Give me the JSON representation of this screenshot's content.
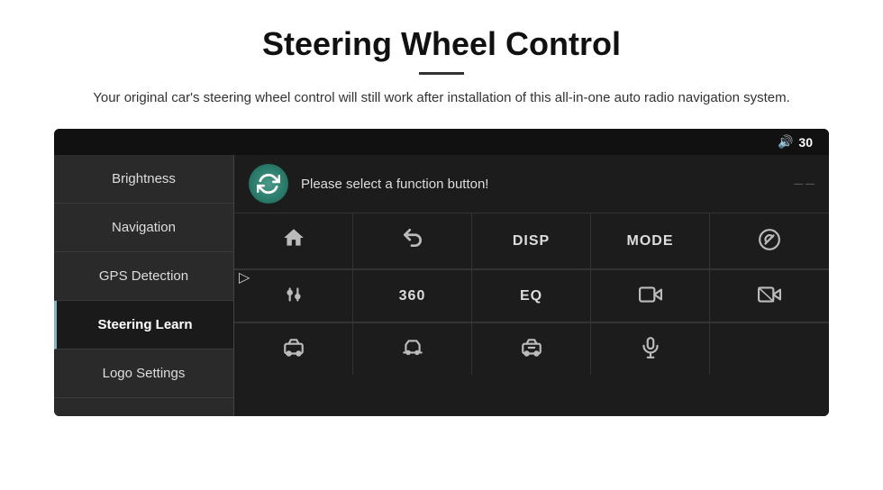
{
  "header": {
    "title": "Steering Wheel Control",
    "subtitle": "Your original car's steering wheel control will still work after installation of this all-in-one auto radio navigation system."
  },
  "screen": {
    "topbar": {
      "volume_label": "30"
    },
    "sidebar": {
      "items": [
        {
          "label": "Brightness",
          "active": false
        },
        {
          "label": "Navigation",
          "active": false
        },
        {
          "label": "GPS Detection",
          "active": false
        },
        {
          "label": "Steering Learn",
          "active": true
        },
        {
          "label": "Logo Settings",
          "active": false
        }
      ]
    },
    "prompt": "Please select a function button!",
    "grid": {
      "row1": [
        {
          "type": "icon",
          "symbol": "🏠",
          "label": "home"
        },
        {
          "type": "icon",
          "symbol": "↩",
          "label": "back"
        },
        {
          "type": "text",
          "symbol": "DISP",
          "label": "disp"
        },
        {
          "type": "text",
          "symbol": "MODE",
          "label": "mode"
        },
        {
          "type": "icon",
          "symbol": "🚫📞",
          "label": "no-call"
        }
      ],
      "row2": [
        {
          "type": "icon",
          "symbol": "⚙",
          "label": "settings"
        },
        {
          "type": "text",
          "symbol": "360",
          "label": "360"
        },
        {
          "type": "text",
          "symbol": "EQ",
          "label": "eq"
        },
        {
          "type": "icon",
          "symbol": "🍺",
          "label": "icon4"
        },
        {
          "type": "icon",
          "symbol": "🎭",
          "label": "icon5"
        }
      ],
      "row3": [
        {
          "type": "icon",
          "symbol": "🚗",
          "label": "car"
        },
        {
          "type": "icon",
          "symbol": "🚙",
          "label": "car2"
        },
        {
          "type": "icon",
          "symbol": "🚘",
          "label": "car3"
        },
        {
          "type": "icon",
          "symbol": "🎤",
          "label": "mic"
        },
        {
          "type": "icon",
          "symbol": "",
          "label": "empty"
        }
      ]
    }
  }
}
